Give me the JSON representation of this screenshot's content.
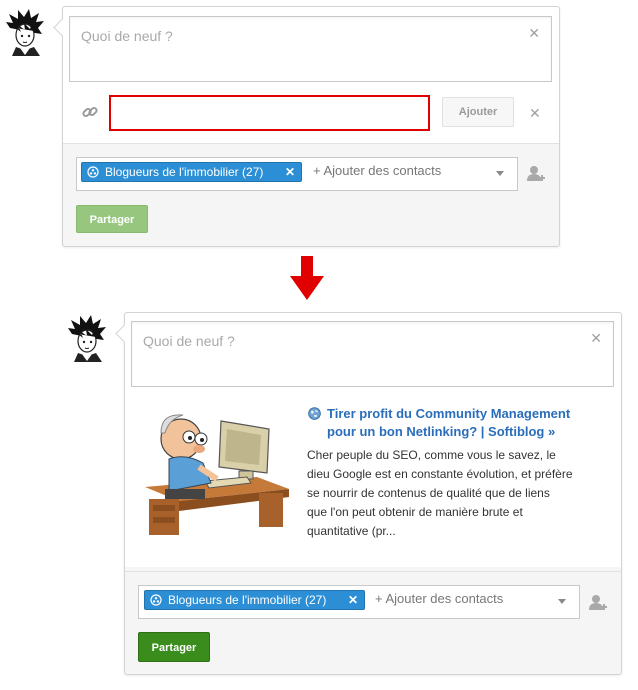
{
  "before": {
    "status": {
      "placeholder": "Quoi de neuf ?"
    },
    "link": {
      "url_value": "",
      "add_label": "Ajouter"
    },
    "share": {
      "chip_label": "Blogueurs de l'immobilier (27)",
      "add_contacts_placeholder": "+ Ajouter des contacts",
      "button_label": "Partager"
    }
  },
  "after": {
    "status": {
      "placeholder": "Quoi de neuf ?"
    },
    "preview": {
      "title_line1": "Tirer profit du Community Management",
      "title_line2": "pour un bon Netlinking? | Softiblog »",
      "desc_lines": [
        "Cher peuple du SEO, comme vous le savez, le",
        "dieu Google est en constante évolution, et préfère",
        "se nourrir de contenus de qualité que de liens",
        "que l'on peut obtenir de manière brute et",
        "quantitative (pr..."
      ]
    },
    "share": {
      "chip_label": "Blogueurs de l'immobilier (27)",
      "add_contacts_placeholder": "+ Ajouter des contacts",
      "button_label": "Partager"
    }
  },
  "colors": {
    "highlight_border": "#e00000",
    "arrow": "#e00000",
    "chip": "#2c8fd6",
    "share_disabled": "#97c77f",
    "share_active": "#3a8d1d",
    "link": "#2a6ebb"
  },
  "icons": [
    "avatar",
    "link-icon",
    "close-icon",
    "circle-icon",
    "chevron-down-icon",
    "add-person-icon",
    "down-arrow-icon",
    "globe-icon"
  ]
}
